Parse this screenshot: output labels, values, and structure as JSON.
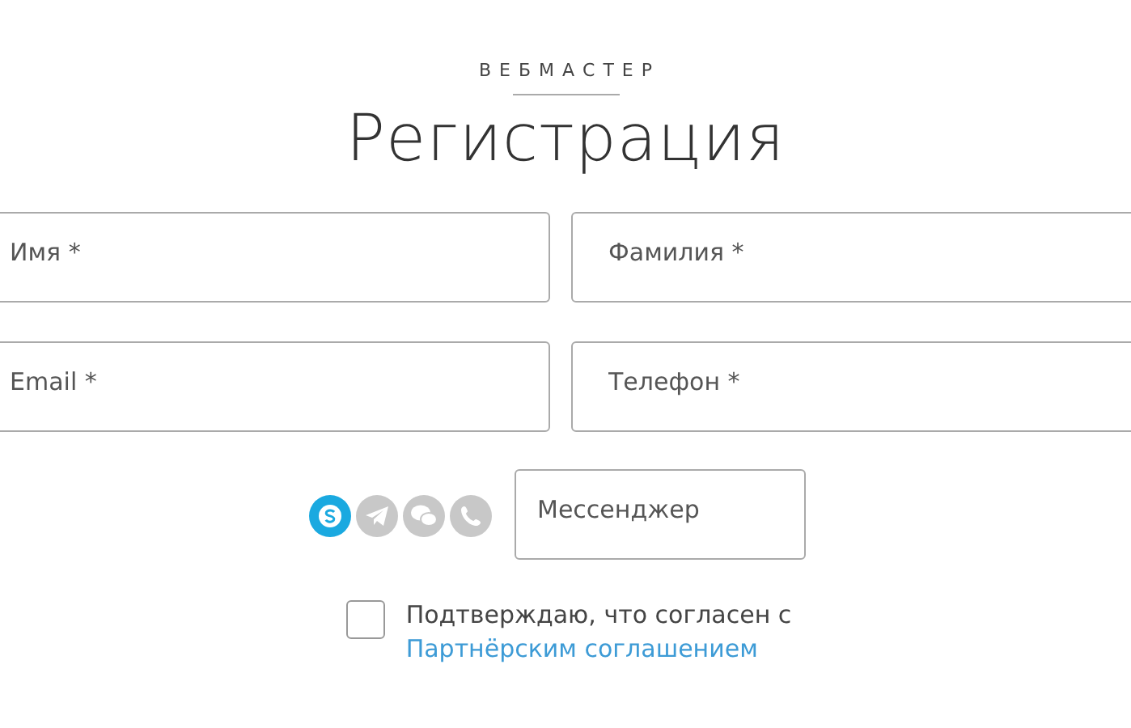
{
  "eyebrow": "ВЕБМАСТЕР",
  "title": "Регистрация",
  "fields": [
    {
      "placeholder": "Имя *"
    },
    {
      "placeholder": "Фамилия *"
    },
    {
      "placeholder": "Email *"
    },
    {
      "placeholder": "Телефон *"
    }
  ],
  "messengers": [
    {
      "kind": "skype",
      "selected": true
    },
    {
      "kind": "telegram",
      "selected": false
    },
    {
      "kind": "wechat",
      "selected": false
    },
    {
      "kind": "whatsapp",
      "selected": false
    }
  ],
  "messenger_field": {
    "placeholder": "Мессенджер"
  },
  "agreement": {
    "checked": false,
    "text": "Подтверждаю, что согласен с",
    "link": "Партнёрским соглашением"
  }
}
